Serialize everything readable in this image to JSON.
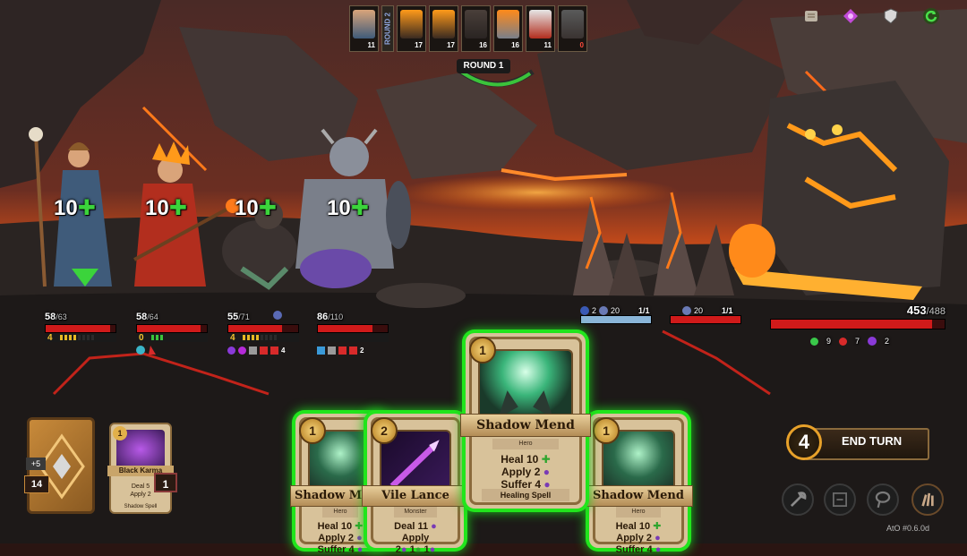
{
  "turn_order": {
    "round2_label": "ROUND 2",
    "round_indicator": "ROUND 1",
    "portraits": [
      {
        "name": "priestess",
        "speed": "11"
      },
      {
        "name": "flame-creature-a",
        "speed": "17"
      },
      {
        "name": "flame-creature-b",
        "speed": "17"
      },
      {
        "name": "rat-scout",
        "speed": "16"
      },
      {
        "name": "demon-knight",
        "speed": "16"
      },
      {
        "name": "fire-monk",
        "speed": "11"
      },
      {
        "name": "golem",
        "speed": "0"
      }
    ]
  },
  "top_right_icons": [
    "map-scroll-icon",
    "gem-icon",
    "shield-icon",
    "refresh-icon"
  ],
  "heroes": [
    {
      "heal": "10",
      "hp": "58",
      "hp_max": "/63",
      "hp_pct": 0.92,
      "energy": "4",
      "energy_pips": 8,
      "energy_on": 4
    },
    {
      "heal": "10",
      "hp": "58",
      "hp_max": "/64",
      "hp_pct": 0.91,
      "energy": "0",
      "energy_pips": 3,
      "energy_on": 0
    },
    {
      "heal": "10",
      "hp": "55",
      "hp_max": "/71",
      "hp_pct": 0.77,
      "energy": "4",
      "energy_pips": 8,
      "energy_on": 4
    },
    {
      "heal": "10",
      "hp": "86",
      "hp_max": "/110",
      "hp_pct": 0.78,
      "energy": "",
      "energy_pips": 0,
      "energy_on": 0
    }
  ],
  "hero_effects": [
    {
      "values": []
    },
    {
      "values": []
    },
    {
      "values": [
        "4"
      ]
    },
    {
      "values": [
        "2"
      ]
    }
  ],
  "enemies": {
    "spike1": {
      "hp": "1/1",
      "shield": "20",
      "stack": "2",
      "hp_pct": 1.0
    },
    "spike2": {
      "hp": "1/1",
      "shield": "20",
      "hp_pct": 1.0
    },
    "boss": {
      "hp": "453",
      "hp_max": "/488",
      "hp_pct": 0.93,
      "buffs": [
        "9",
        "7",
        "2"
      ]
    }
  },
  "deck": {
    "bonus": "+5",
    "count": "14"
  },
  "discard": {
    "card_name": "Black Karma",
    "cost": "1",
    "line1": "Deal 5",
    "line2": "Apply 2",
    "footer": "Shadow Spell",
    "count": "1"
  },
  "hand": [
    {
      "name": "Shadow Mend",
      "cost": "1",
      "type": "Hero",
      "heal": "10",
      "apply": "2",
      "suffer": "4",
      "footer": "Healing Spell"
    },
    {
      "name": "Vile Lance",
      "cost": "2",
      "type": "Monster",
      "deal": "11",
      "apply_label": "Apply",
      "apply_vals": [
        "2",
        "1",
        "1"
      ],
      "footer": ""
    },
    {
      "name": "Shadow Mend",
      "cost": "1",
      "type": "Hero",
      "heal": "10",
      "apply": "2",
      "suffer": "4",
      "footer": "Healing Spell"
    },
    {
      "name": "Shadow Mend",
      "cost": "1",
      "type": "Hero",
      "heal": "10",
      "apply": "2",
      "suffer": "4",
      "footer": "Healing Spell"
    }
  ],
  "labels": {
    "heal": "Heal",
    "apply": "Apply",
    "suffer": "Suffer",
    "deal": "Deal"
  },
  "end_turn": {
    "energy": "4",
    "label": "END TURN"
  },
  "action_icons": [
    "axe-icon",
    "rune-icon",
    "lasso-icon",
    "claw-icon"
  ],
  "version": "AtO #0.6.0d"
}
